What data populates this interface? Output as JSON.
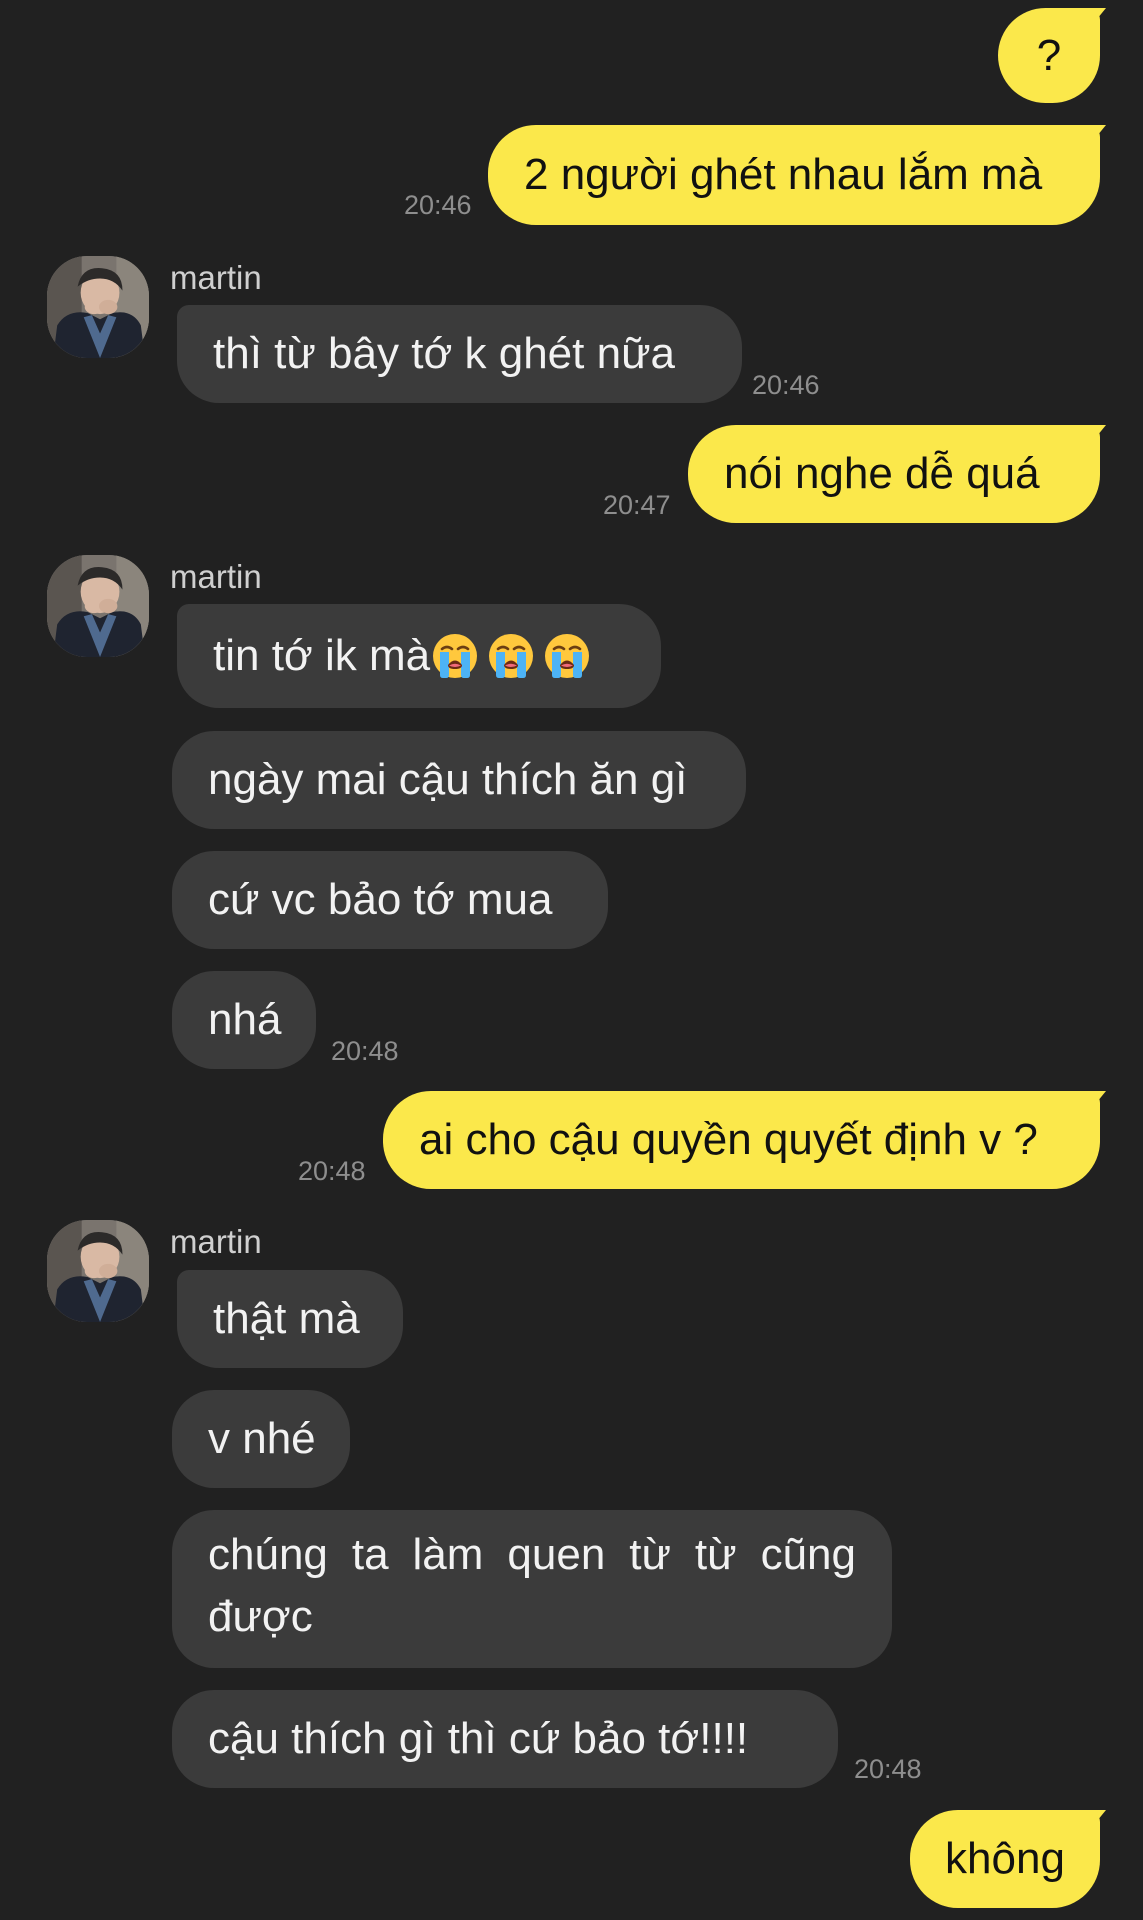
{
  "theme": {
    "background": "#212121",
    "outgoing_bubble": "#FBE84B",
    "incoming_bubble": "#3B3B3B",
    "timestamp_color": "#8E8E8E"
  },
  "messages": {
    "m1": {
      "text": "?"
    },
    "m2": {
      "text": "2 người ghét nhau lắm mà",
      "time": "20:46"
    },
    "g1": {
      "sender": "martin",
      "avatar_icon": "profile-photo",
      "m1": {
        "text": "thì từ bây tớ k ghét nữa",
        "time": "20:46"
      }
    },
    "m3": {
      "text": "nói nghe dễ quá",
      "time": "20:47"
    },
    "g2": {
      "sender": "martin",
      "avatar_icon": "profile-photo",
      "m1": {
        "text": "tin tớ ik mà",
        "emoji": [
          "loudly-crying-face",
          "loudly-crying-face",
          "loudly-crying-face"
        ]
      },
      "m2": {
        "text": "ngày mai cậu thích ăn gì"
      },
      "m3": {
        "text": "cứ vc bảo tớ mua"
      },
      "m4": {
        "text": "nhá",
        "time": "20:48"
      }
    },
    "m4": {
      "text": "ai cho cậu quyền quyết định v ?",
      "time": "20:48"
    },
    "g3": {
      "sender": "martin",
      "avatar_icon": "profile-photo",
      "m1": {
        "text": "thật mà"
      },
      "m2": {
        "text": "v nhé"
      },
      "m3": {
        "text": "chúng ta làm quen từ từ cũng được"
      },
      "m4": {
        "text": "cậu thích gì thì cứ bảo tớ!!!!",
        "time": "20:48"
      }
    },
    "m5": {
      "text": "không"
    }
  }
}
